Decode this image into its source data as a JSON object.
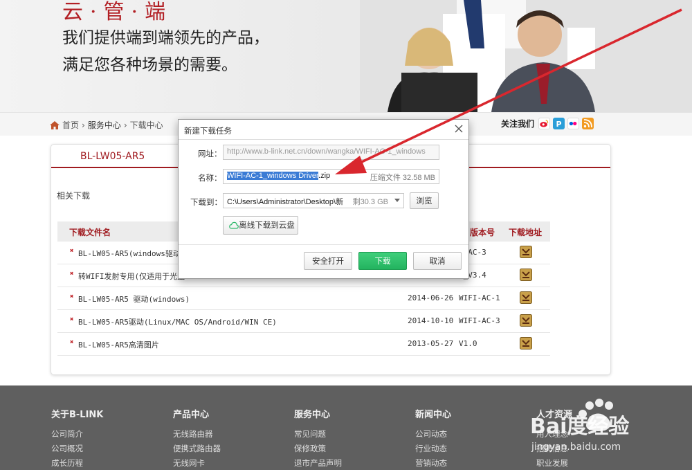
{
  "banner": {
    "brand_line": "云·管·端",
    "slogan_line1": "我们提供端到端领先的产品，",
    "slogan_line2": "满足您各种场景的需要。"
  },
  "breadcrumb": {
    "home": "首页",
    "sep": "›",
    "service": "服务中心",
    "download": "下载中心"
  },
  "follow": {
    "label": "关注我们",
    "icons": [
      "weibo-icon",
      "tencent-icon",
      "flickr-icon",
      "rss-icon"
    ]
  },
  "product": {
    "title": "BL-LW05-AR5",
    "related": "相关下载"
  },
  "table": {
    "headers": {
      "file": "下载文件名",
      "version": "版本号",
      "download": "下载地址"
    },
    "rows": [
      {
        "name": "BL-LW05-AR5(windows驱动，含",
        "date": "",
        "version": "I-AC-3"
      },
      {
        "name": "转WIFI发射专用(仅适用于光盘",
        "date": "",
        "version": "I_V3.4"
      },
      {
        "name": "BL-LW05-AR5 驱动(windows)",
        "date": "2014-06-26",
        "version": "WIFI-AC-1"
      },
      {
        "name": "BL-LW05-AR5驱动(Linux/MAC OS/Android/WIN CE)",
        "date": "2014-10-10",
        "version": "WIFI-AC-3"
      },
      {
        "name": "BL-LW05-AR5高清图片",
        "date": "2013-05-27",
        "version": "V1.0"
      }
    ]
  },
  "dialog": {
    "title": "新建下载任务",
    "url_label": "网址：",
    "url_value": "http://www.b-link.net.cn/down/wangka/WIFI-AC-1_windows",
    "name_label": "名称：",
    "name_selected": "WIFI-AC-1_windows Driver",
    "name_ext": ".zip",
    "file_info": "压缩文件 32.58 MB",
    "saveto_label": "下载到：",
    "saveto_path": "C:\\Users\\Administrator\\Desktop\\新",
    "free_space": "剩30.3 GB",
    "browse": "浏览",
    "cloud": "离线下载到云盘",
    "safe_open": "安全打开",
    "download": "下载",
    "cancel": "取消"
  },
  "footer": {
    "columns": [
      {
        "title": "关于B-LINK",
        "items": [
          "公司简介",
          "公司概况",
          "成长历程"
        ]
      },
      {
        "title": "产品中心",
        "items": [
          "无线路由器",
          "便携式路由器",
          "无线网卡"
        ]
      },
      {
        "title": "服务中心",
        "items": [
          "常见问题",
          "保修政策",
          "退市产品声明"
        ]
      },
      {
        "title": "新闻中心",
        "items": [
          "公司动态",
          "行业动态",
          "营销动态"
        ]
      },
      {
        "title": "人才资源",
        "items": [
          "用人理念",
          "招聘信息",
          "职业发展"
        ]
      }
    ],
    "watermark_text": "Bai度经验",
    "watermark_url": "jingyan.baidu.com"
  },
  "colors": {
    "brand": "#a01b20",
    "accent_green": "#23b35f",
    "selection": "#3a7bd5",
    "arrow": "#d9272e"
  }
}
